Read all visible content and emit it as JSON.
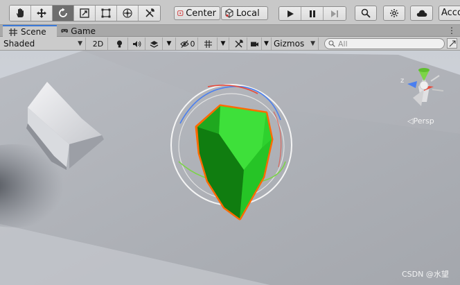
{
  "toolbar": {
    "tools": [
      {
        "name": "hand-tool",
        "active": false
      },
      {
        "name": "move-tool",
        "active": false
      },
      {
        "name": "rotate-tool",
        "active": true
      },
      {
        "name": "scale-tool",
        "active": false
      },
      {
        "name": "rect-tool",
        "active": false
      },
      {
        "name": "transform-tool",
        "active": false
      },
      {
        "name": "custom-tool",
        "active": false
      }
    ],
    "pivot_label": "Center",
    "space_label": "Local",
    "account_label": "Account"
  },
  "tabs": [
    {
      "label": "Scene",
      "icon": "grid-icon",
      "active": true
    },
    {
      "label": "Game",
      "icon": "gamepad-icon",
      "active": false
    }
  ],
  "scene_toolbar": {
    "shading_mode": "Shaded",
    "mode_2d": "2D",
    "hidden_count": "0",
    "gizmos_label": "Gizmos",
    "search_placeholder": "All"
  },
  "viewport": {
    "orientation_label": "◁Persp",
    "gizmo_axis_label": "z",
    "watermark": "CSDN @水望",
    "colors": {
      "object_fill": "#2ed12e",
      "object_dark": "#0f7a0f",
      "selection_outline": "#ff6a00",
      "axis_red": "#e84a3a",
      "axis_green": "#7cd448",
      "axis_blue": "#4a7ff0"
    }
  }
}
